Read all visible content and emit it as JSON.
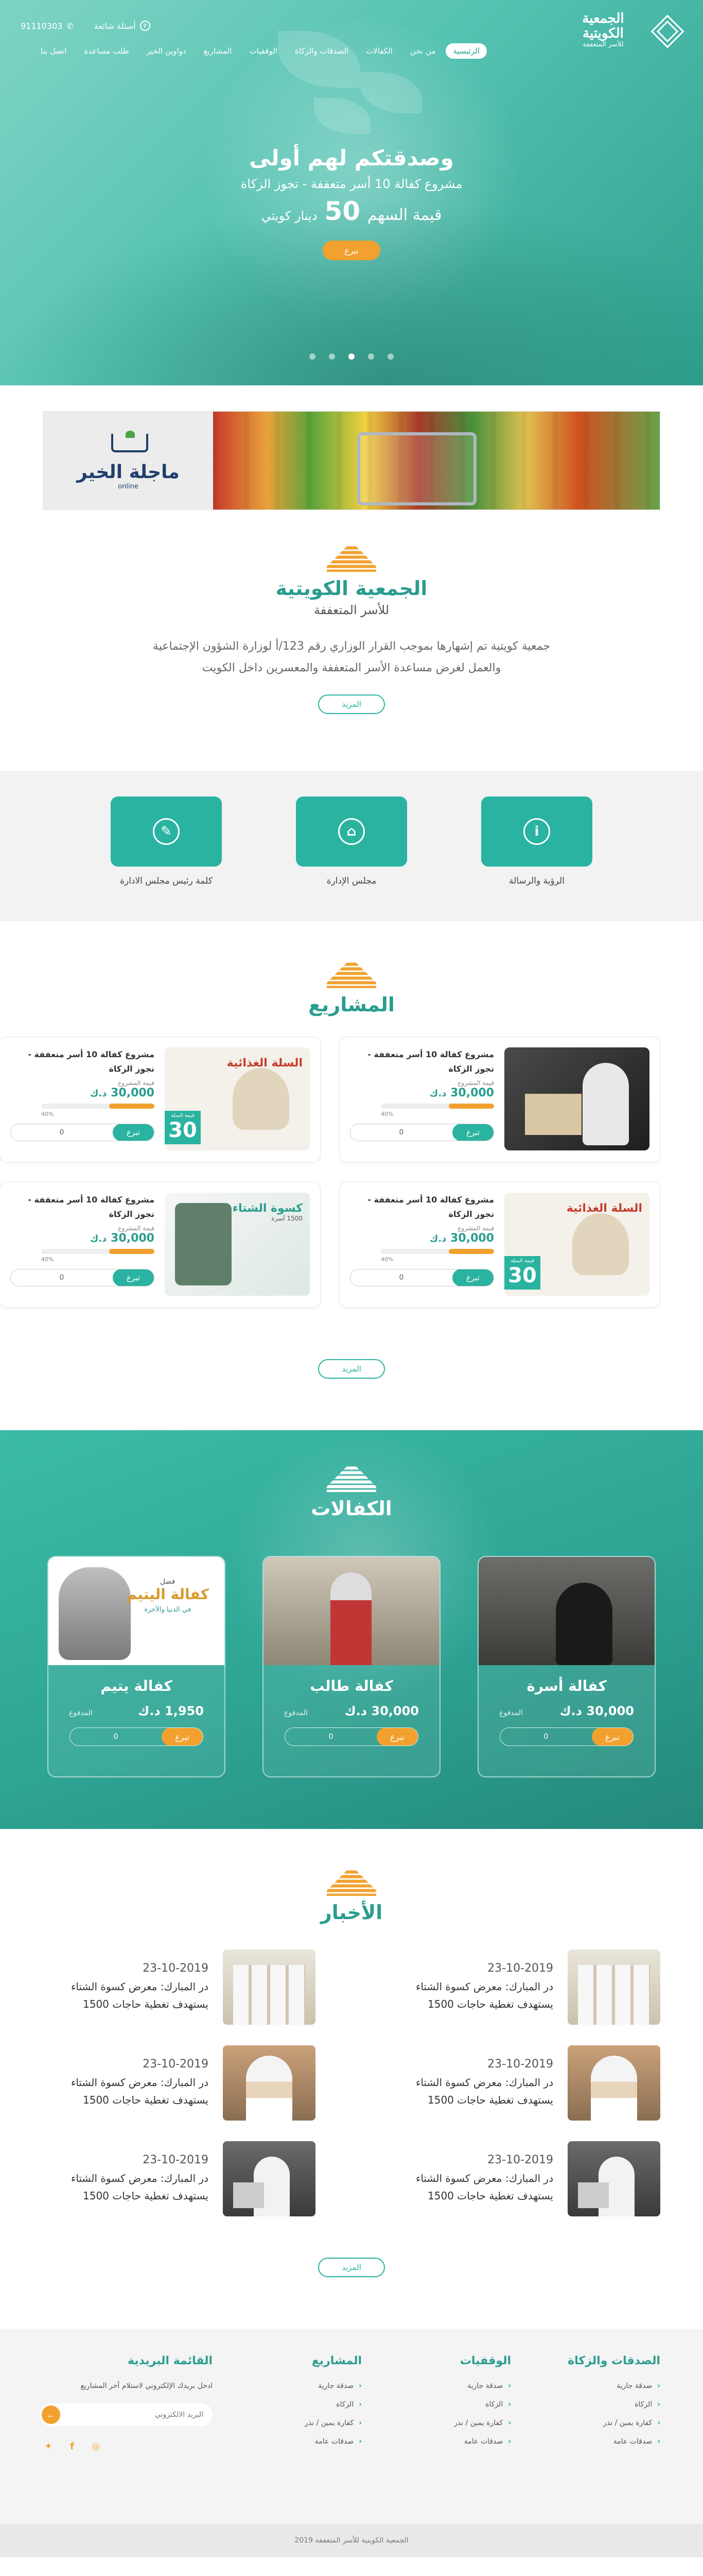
{
  "header": {
    "logo_title": "الجمعية الكويتية",
    "logo_sub": "للأسر المتعففة",
    "nav": [
      "الرئيسية",
      "من نحن",
      "الكفالات",
      "الصدقات والزكاة",
      "الوقفيات",
      "المشاريع",
      "دواوين الخير",
      "طلب مساعدة",
      "اتصل بنا"
    ],
    "phone": "91110303",
    "faq": "أسئلة شائعة"
  },
  "hero": {
    "title": "وصدقتكم لهم أولى",
    "subtitle": "مشروع كفالة 10 أسر متعففة - تجوز الزكاة",
    "price_label": "قيمة السهم",
    "price_value": "50",
    "price_currency": "دينار كويتي",
    "donate": "تبرع",
    "slides": 5,
    "active_slide": 3
  },
  "banner": {
    "brand": "ماجلة الخير",
    "online": "online"
  },
  "about": {
    "title": "الجمعية الكويتية",
    "subtitle": "للأسر المتعففة",
    "description": "جمعية كويتية تم إشهارها بموجب القرار الوزاري رقم 123/أ لوزارة الشؤون الإجتماعية والعمل لغرض مساعدة الأسر المتعففة والمعسرين داخل الكويت",
    "more": "المزيد"
  },
  "pillars": [
    {
      "label": "الرؤية والرسالة",
      "icon": "info-icon",
      "glyph": "i"
    },
    {
      "label": "مجلس الإدارة",
      "icon": "team-icon",
      "glyph": "⌂"
    },
    {
      "label": "كلمة رئيس مجلس الادارة",
      "icon": "document-icon",
      "glyph": "✎"
    }
  ],
  "projects": {
    "title": "المشاريع",
    "more": "المزيد",
    "items": [
      {
        "title": "مشروع كفالة 10 أسر متعففة - تجوز الزكاة",
        "label": "قيمة المشروع",
        "amount": "30,000",
        "currency": "د.ك",
        "progress": 40,
        "progress_text": "40%",
        "input": "0",
        "donate": "تبرع",
        "image": "dark",
        "badge_top": "",
        "badge_small": "",
        "badge_num": ""
      },
      {
        "title": "مشروع كفالة 10 أسر متعففة - تجوز الزكاة",
        "label": "قيمة المشروع",
        "amount": "30,000",
        "currency": "د.ك",
        "progress": 40,
        "progress_text": "40%",
        "input": "0",
        "donate": "تبرع",
        "image": "light",
        "badge_top": "السلة الغذائية",
        "badge_small": "قيمة السلة",
        "badge_num": "30"
      },
      {
        "title": "مشروع كفالة 10 أسر متعففة - تجوز الزكاة",
        "label": "قيمة المشروع",
        "amount": "30,000",
        "currency": "د.ك",
        "progress": 40,
        "progress_text": "40%",
        "input": "0",
        "donate": "تبرع",
        "image": "light",
        "badge_top": "السلة الغذائية",
        "badge_small": "قيمة السلة",
        "badge_num": "30"
      },
      {
        "title": "مشروع كفالة 10 أسر متعففة - تجوز الزكاة",
        "label": "قيمة المشروع",
        "amount": "30,000",
        "currency": "د.ك",
        "progress": 40,
        "progress_text": "40%",
        "input": "0",
        "donate": "تبرع",
        "image": "coat",
        "badge_top": "كسوة الشتاء",
        "badge_small": "1500 أسرة",
        "badge_num": ""
      }
    ]
  },
  "sponsorships": {
    "title": "الكفالات",
    "items": [
      {
        "name": "كفالة أسرة",
        "paid_label": "المدفوع",
        "paid_value": "30,000",
        "currency": "د.ك",
        "input": "0",
        "donate": "تبرع",
        "image": "family"
      },
      {
        "name": "كفالة طالب",
        "paid_label": "المدفوع",
        "paid_value": "30,000",
        "currency": "د.ك",
        "input": "0",
        "donate": "تبرع",
        "image": "student"
      },
      {
        "name": "كفالة يتيم",
        "paid_label": "المدفوع",
        "paid_value": "1,950",
        "currency": "د.ك",
        "input": "0",
        "donate": "تبرع",
        "image": "orphan",
        "img_small": "فضل",
        "img_big": "كفالة اليتيم",
        "img_note": "في الدنيا والآخرة"
      }
    ]
  },
  "news": {
    "title": "الأخبار",
    "more": "المزيد",
    "items": [
      {
        "date": "23-10-2019",
        "title": "در المبارك: معرض كسوة الشتاء يستهدف تغطية حاجات 1500",
        "image": "a"
      },
      {
        "date": "23-10-2019",
        "title": "در المبارك: معرض كسوة الشتاء يستهدف تغطية حاجات 1500",
        "image": "a"
      },
      {
        "date": "23-10-2019",
        "title": "در المبارك: معرض كسوة الشتاء يستهدف تغطية حاجات 1500",
        "image": "b"
      },
      {
        "date": "23-10-2019",
        "title": "در المبارك: معرض كسوة الشتاء يستهدف تغطية حاجات 1500",
        "image": "b"
      },
      {
        "date": "23-10-2019",
        "title": "در المبارك: معرض كسوة الشتاء يستهدف تغطية حاجات 1500",
        "image": "c"
      },
      {
        "date": "23-10-2019",
        "title": "در المبارك: معرض كسوة الشتاء يستهدف تغطية حاجات 1500",
        "image": "c"
      }
    ]
  },
  "footer": {
    "cols": [
      {
        "title": "الصدقات والزكاة",
        "items": [
          "صدقة جارية",
          "الزكاة",
          "كفارة يمين / نذر",
          "صدقات عامة"
        ]
      },
      {
        "title": "الوقفيات",
        "items": [
          "صدقة جارية",
          "الزكاة",
          "كفارة يمين / نذر",
          "صدقات عامة"
        ]
      },
      {
        "title": "المشاريع",
        "items": [
          "صدقة جارية",
          "الزكاة",
          "كفارة يمين / نذر",
          "صدقات عامة"
        ]
      }
    ],
    "newsletter_title": "القائمة البريدية",
    "newsletter_desc": "ادخل بريدك الإلكتروني لاستلام آخر المشاريع",
    "newsletter_placeholder": "البريد الالكتروني",
    "copyright": "الجمعية الكويتية للأسر المتعففة 2019"
  },
  "colors": {
    "primary": "#2ab3a0",
    "accent": "#f2a12e",
    "heading": "#2a9d8f"
  }
}
